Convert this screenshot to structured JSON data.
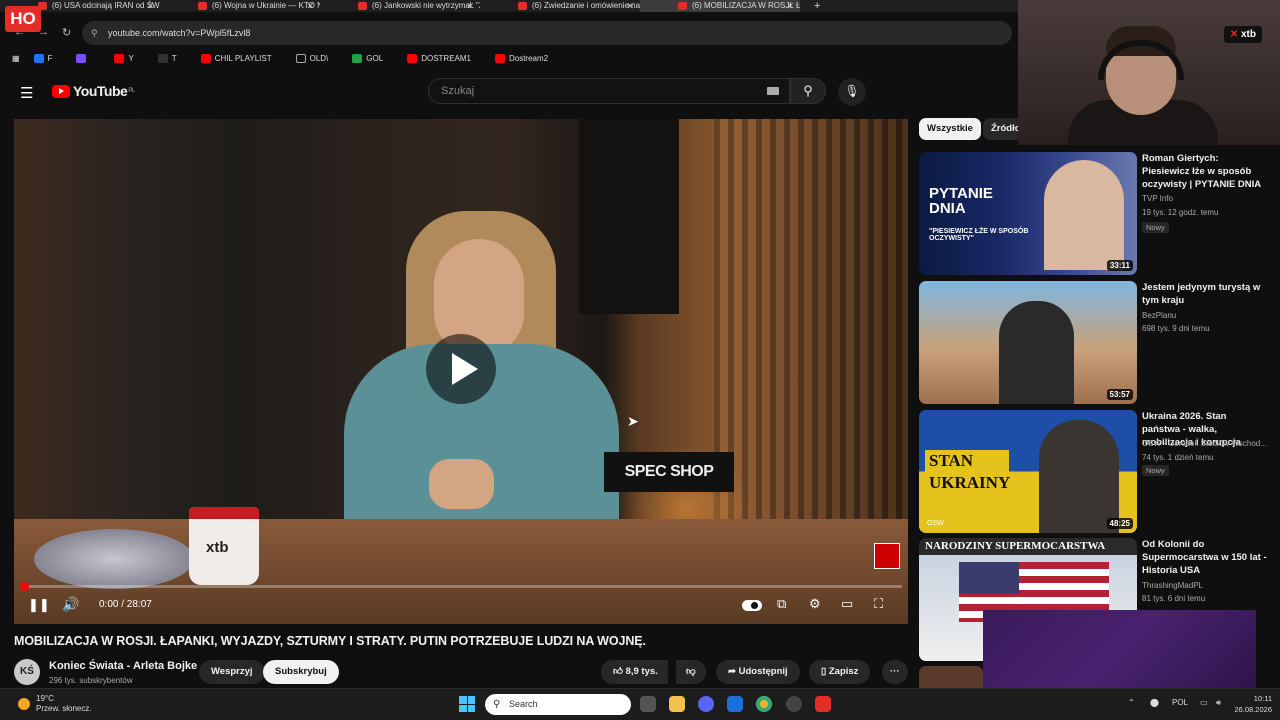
{
  "browser": {
    "logo_badge": "HO",
    "tabs": [
      {
        "title": "(6) USA odcinają IRAN od ŚWIA"
      },
      {
        "title": "(6) Wojna w Ukrainie — KTO N"
      },
      {
        "title": "(6) Jankowski nie wytrzymał. \"Z"
      },
      {
        "title": "(6) Zwiedzanie i omówienie naj"
      },
      {
        "title": "(6) MOBILIZACJA W ROSJI. Ł"
      }
    ],
    "new_tab": "+",
    "url": "youtube.com/watch?v=PWpl5fLzvl8",
    "bookmarks": [
      {
        "label": "F",
        "color": "#1877f2"
      },
      {
        "label": "",
        "color": "#7c4dff"
      },
      {
        "label": "Y",
        "color": "#ff0000"
      },
      {
        "label": "T",
        "color": "#333333"
      },
      {
        "label": "CHIL PLAYLIST",
        "color": "#ff0000"
      },
      {
        "label": "OLD\\",
        "color": "#888888"
      },
      {
        "label": "GOL",
        "color": "#1ea446"
      },
      {
        "label": "DOSTREAM1",
        "color": "#ff0000"
      },
      {
        "label": "Dostream2",
        "color": "#ff0000"
      }
    ]
  },
  "youtube": {
    "logo_text": "YouTube",
    "region": "PL",
    "search_placeholder": "Szukaj"
  },
  "player": {
    "current_time": "0:00",
    "duration": "28:07",
    "time_display": "0:00 / 28:07",
    "progress_fraction": 0.0,
    "mug_brand": "xtb",
    "sign_text": "SPEC SHOP"
  },
  "video": {
    "title": "MOBILIZACJA W ROSJI. ŁAPANKI, WYJAZDY, SZTURMY I STRATY. PUTIN POTRZEBUJE LUDZI NA WOJNĘ.",
    "channel_initials": "KŚ",
    "channel_name": "Koniec Świata - Arleta Bojke",
    "subscribers": "296 tys. subskrybentów",
    "support_label": "Wesprzyj",
    "subscribe_label": "Subskrybuj",
    "likes": "8,9 tys.",
    "share_label": "Udostępnij",
    "save_label": "Zapisz"
  },
  "filters": [
    "Wszystkie",
    "Źródło"
  ],
  "recommendations": [
    {
      "title": "Roman Giertych: Piesiewicz łże w sposób oczywisty | PYTANIE DNIA",
      "channel": "TVP Info",
      "stats": "19 tys.  12 godz. temu",
      "badge": "Nowy",
      "duration": "33:11",
      "thumb_text": "PYTANIE DNIA",
      "thumb_sub": "\"PIESIEWICZ ŁŻE W SPOSÓB OCZYWISTY\""
    },
    {
      "title": "Jestem jedynym turystą w tym kraju",
      "channel": "BezPlanu",
      "stats": "698 tys.  9 dni temu",
      "badge": "",
      "duration": "53:57",
      "thumb_text": "",
      "thumb_sub": ""
    },
    {
      "title": "Ukraina 2026. Stan państwa - walka, mobilizacja i korupcja",
      "channel": "OSW - Ośrodek Studiów Wschod...",
      "stats": "74 tys.  1 dzień temu",
      "badge": "Nowy",
      "duration": "48:25",
      "thumb_text": "STAN UKRAINY",
      "thumb_sub": "OSW"
    },
    {
      "title": "Od Kolonii do Supermocarstwa w 150 lat - Historia USA",
      "channel": "ThrashingMadPL",
      "stats": "81 tys.  6 dni temu",
      "badge": "",
      "duration": "",
      "thumb_text": "NARODZINY SUPERMOCARSTWA",
      "thumb_sub": ""
    }
  ],
  "overlay": {
    "webcam_brand": "xtb"
  },
  "taskbar": {
    "temperature": "19°C",
    "weather_desc": "Przew. słonecz.",
    "search_placeholder": "Search",
    "language": "POL",
    "time": "10:11",
    "date": "26.08.2026"
  }
}
